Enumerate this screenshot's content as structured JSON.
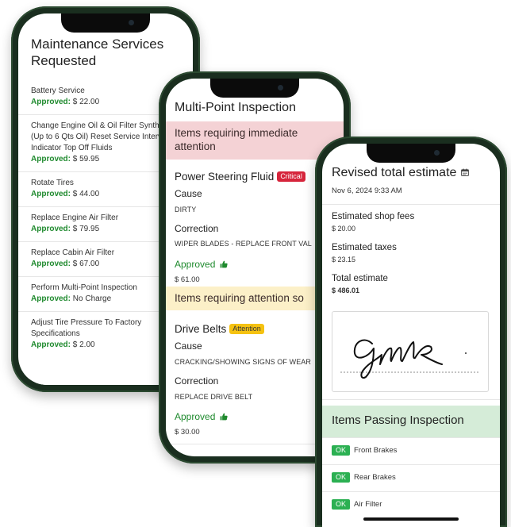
{
  "screen1": {
    "title": "Maintenance Services Requested",
    "approved_label": "Approved:",
    "services": [
      {
        "name": "Battery Service",
        "price": "$ 22.00"
      },
      {
        "name": "Change Engine Oil & Oil Filter Synthe\n(Up to 6 Qts Oil) Reset Service Interv\nIndicator Top Off Fluids",
        "price": "$ 59.95"
      },
      {
        "name": "Rotate Tires",
        "price": "$ 44.00"
      },
      {
        "name": "Replace Engine Air Filter",
        "price": "$ 79.95"
      },
      {
        "name": "Replace Cabin Air Filter",
        "price": "$ 67.00"
      },
      {
        "name": "Perform Multi-Point Inspection",
        "price": "No Charge"
      },
      {
        "name": "Adjust Tire Pressure To Factory\nSpecifications",
        "price": "$ 2.00"
      }
    ]
  },
  "screen2": {
    "title": "Multi-Point Inspection",
    "immediate_header": "Items requiring immediate attention",
    "soon_header": "Items requiring attention so",
    "cause_label": "Cause",
    "correction_label": "Correction",
    "approved_text": "Approved",
    "items": [
      {
        "name": "Power Steering Fluid",
        "badge": "Critical",
        "cause": "DIRTY",
        "correction": "WIPER BLADES - REPLACE FRONT VAL",
        "price": "$ 61.00"
      },
      {
        "name": "Drive Belts",
        "badge": "Attention",
        "cause": "CRACKING/SHOWING SIGNS OF WEAR",
        "correction": "REPLACE DRIVE BELT",
        "price": "$ 30.00"
      }
    ]
  },
  "screen3": {
    "title": "Revised total estimate",
    "date": "Nov 6, 2024 9:33 AM",
    "shop_fees_label": "Estimated shop fees",
    "shop_fees": "$ 20.00",
    "taxes_label": "Estimated taxes",
    "taxes": "$ 23.15",
    "total_label": "Total estimate",
    "total": "$ 486.01",
    "passing_header": "Items Passing Inspection",
    "ok_label": "OK",
    "passing": [
      "Front Brakes",
      "Rear Brakes",
      "Air Filter"
    ]
  },
  "colors": {
    "approved_green": "#1f8a2e",
    "critical_red": "#d6253c",
    "attention_yellow": "#f5c211",
    "ok_green": "#2bb052",
    "phone_frame": "#1a2e1f"
  },
  "icons": [
    "thumbs-up-icon",
    "calendar-icon"
  ]
}
